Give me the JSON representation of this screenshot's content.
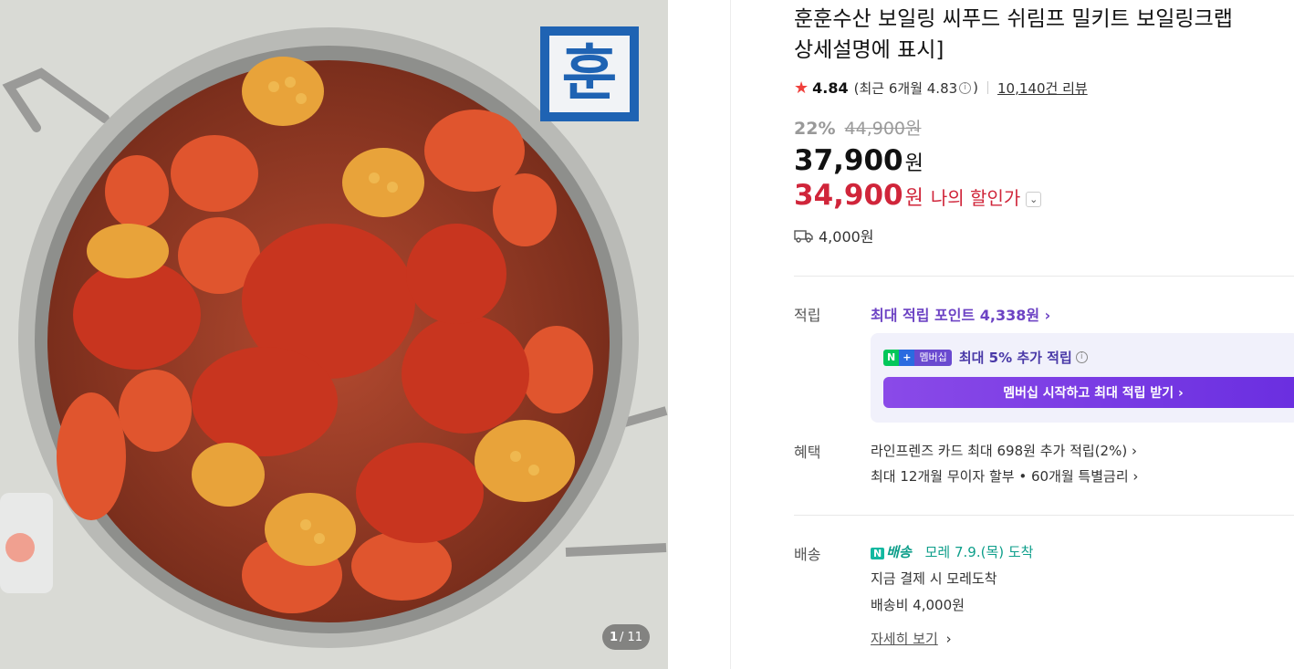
{
  "gallery": {
    "logo_text": "훈",
    "counter_current": "1",
    "counter_total": "/ 11"
  },
  "product": {
    "title_line1": "훈훈수산 보일링 씨푸드 쉬림프 밀키트 보일링크랩",
    "title_line2": "상세설명에 표시]",
    "rating": "4.84",
    "recent_rating_prefix": "(최근 6개월 4.83",
    "recent_rating_suffix": ")",
    "review_count": "10,140건 리뷰",
    "discount_rate": "22%",
    "original_price": "44,900원",
    "price": "37,900",
    "price_unit": "원",
    "my_price": "34,900",
    "my_price_unit": "원",
    "my_price_label": "나의 할인가",
    "shipping_fee": "4,000원"
  },
  "points": {
    "label": "적립",
    "max_points": "최대 적립 포인트 4,338원 ›",
    "badge_n": "N",
    "badge_plus": "+",
    "badge_membership": "멤버십",
    "membership_text": "최대 5% 추가 적립",
    "membership_button": "멤버십 시작하고 최대 적립 받기 ›"
  },
  "benefits": {
    "label": "혜택",
    "line1": "라인프렌즈 카드 최대 698원 추가 적립(2%) ›",
    "line2": "최대 12개월 무이자 할부 • 60개월 특별금리 ›"
  },
  "delivery": {
    "label": "배송",
    "badge": "N",
    "service": "배송",
    "arrival": "모레 7.9.(목) 도착",
    "line2": "지금 결제 시 모레도착",
    "line3": "배송비 4,000원",
    "detail_link": "자세히 보기",
    "detail_arrow": "›"
  },
  "colors": {
    "accent_red": "#d0253a",
    "accent_purple": "#6d43c4",
    "delivery_teal": "#0d9e8a"
  }
}
